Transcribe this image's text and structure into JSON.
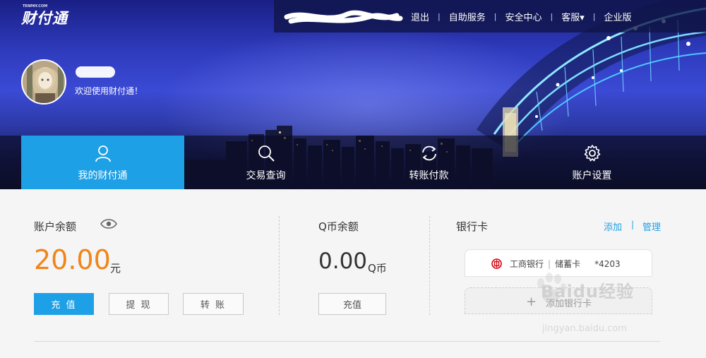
{
  "brand": {
    "logo": "财付通",
    "logo_small": "TENPAY.COM"
  },
  "topnav": {
    "items": [
      "退出",
      "自助服务",
      "安全中心",
      "客服▾",
      "企业版"
    ],
    "separator": "|"
  },
  "user": {
    "welcome": "欢迎使用财付通！"
  },
  "tabs": [
    {
      "label": "我的财付通",
      "icon": "user-icon",
      "active": true
    },
    {
      "label": "交易查询",
      "icon": "search-icon",
      "active": false
    },
    {
      "label": "转账付款",
      "icon": "refresh-icon",
      "active": false
    },
    {
      "label": "账户设置",
      "icon": "gear-icon",
      "active": false
    }
  ],
  "balance": {
    "title": "账户余额",
    "amount": "20.00",
    "unit": "元",
    "buttons": {
      "recharge": "充 值",
      "withdraw": "提 现",
      "transfer": "转 账"
    }
  },
  "qcoin": {
    "title": "Q币余额",
    "amount": "0.00",
    "unit": "Q币",
    "recharge": "充值"
  },
  "bankcard": {
    "title": "银行卡",
    "add": "添加",
    "separator": "|",
    "manage": "管理",
    "card": {
      "bank": "工商银行",
      "type": "储蓄卡",
      "number": "*4203"
    },
    "add_card": "添加银行卡"
  },
  "watermark": {
    "text": "Baidu经验",
    "url": "jingyan.baidu.com"
  },
  "colors": {
    "accent": "#1ea0e6",
    "amount": "#f08519",
    "hero": "#2f3cbf"
  }
}
